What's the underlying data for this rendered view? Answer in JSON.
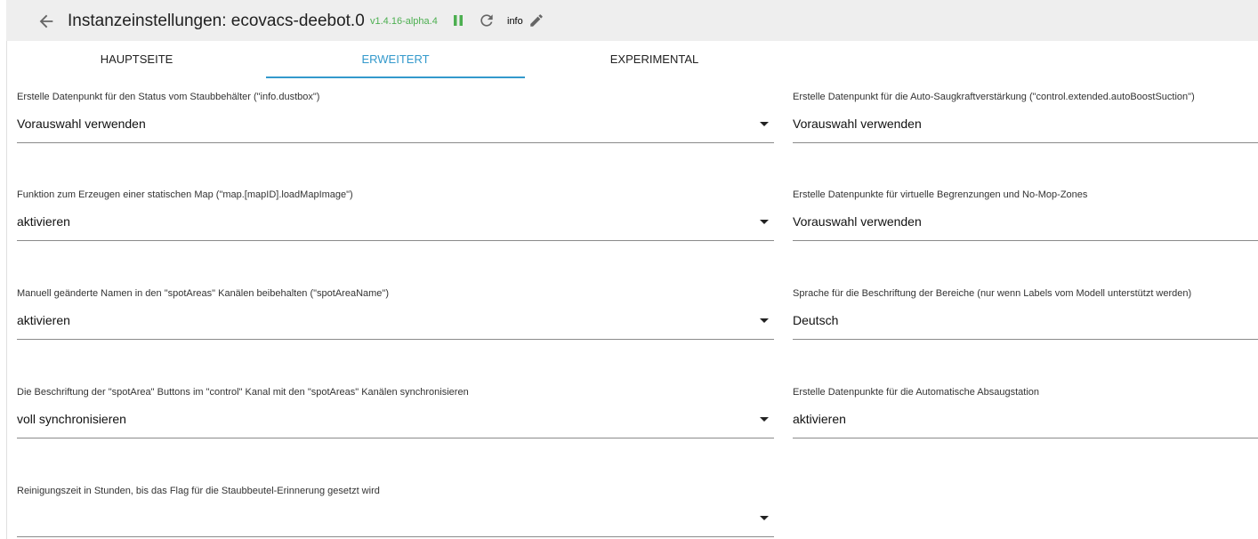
{
  "header": {
    "title": "Instanzeinstellungen: ecovacs-deebot.0",
    "version": "v1.4.16-alpha.4",
    "loglevel": "info",
    "icons": {
      "back": "arrow-left-icon",
      "pause": "pause-icon",
      "reload": "reload-icon",
      "edit": "pencil-icon"
    },
    "colors": {
      "version": "#4caf50",
      "pause": "#4caf50",
      "accent": "#3399cc"
    }
  },
  "tabs": [
    {
      "label": "HAUPTSEITE",
      "active": false
    },
    {
      "label": "ERWEITERT",
      "active": true
    },
    {
      "label": "EXPERIMENTAL",
      "active": false
    }
  ],
  "left_fields": [
    {
      "label": "Erstelle Datenpunkt für den Status vom Staubbehälter (\"info.dustbox\")",
      "value": "Vorauswahl verwenden"
    },
    {
      "label": "Funktion zum Erzeugen einer statischen Map (\"map.[mapID].loadMapImage\")",
      "value": "aktivieren"
    },
    {
      "label": "Manuell geänderte Namen in den \"spotAreas\" Kanälen beibehalten (\"spotAreaName\")",
      "value": "aktivieren"
    },
    {
      "label": "Die Beschriftung der \"spotArea\" Buttons im \"control\" Kanal mit den \"spotAreas\" Kanälen synchronisieren",
      "value": "voll synchronisieren"
    },
    {
      "label": "Reinigungszeit in Stunden, bis das Flag für die Staubbeutel-Erinnerung gesetzt wird",
      "value": ""
    }
  ],
  "right_fields": [
    {
      "label": "Erstelle Datenpunkt für die Auto-Saugkraftverstärkung (\"control.extended.autoBoostSuction\")",
      "value": "Vorauswahl verwenden"
    },
    {
      "label": "Erstelle Datenpunkte für virtuelle Begrenzungen und No-Mop-Zones",
      "value": "Vorauswahl verwenden"
    },
    {
      "label": "Sprache für die Beschriftung der Bereiche (nur wenn Labels vom Modell unterstützt werden)",
      "value": "Deutsch"
    },
    {
      "label": "Erstelle Datenpunkte für die Automatische Absaugstation",
      "value": "aktivieren"
    }
  ]
}
